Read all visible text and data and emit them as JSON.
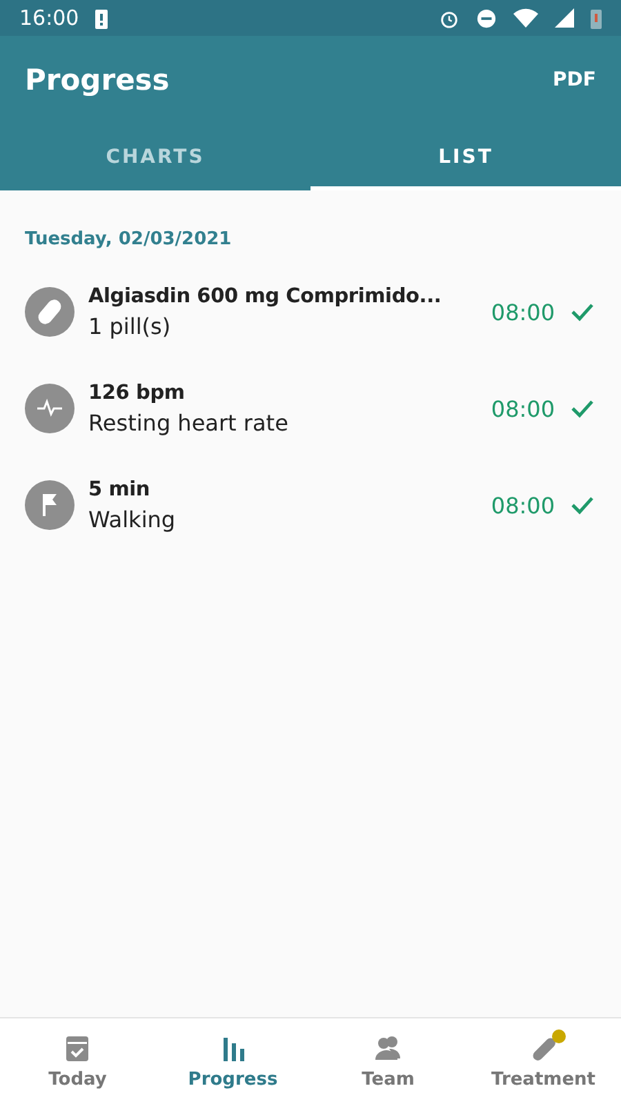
{
  "status_bar": {
    "time": "16:00"
  },
  "app_bar": {
    "title": "Progress",
    "action": "PDF"
  },
  "tabs": [
    {
      "label": "CHARTS",
      "selected": false
    },
    {
      "label": "LIST",
      "selected": true
    }
  ],
  "date_header": "Tuesday, 02/03/2021",
  "entries": [
    {
      "kind": "pill",
      "title": "Algiasdin 600 mg Comprimido...",
      "subtitle": "1 pill(s)",
      "time": "08:00",
      "done": true
    },
    {
      "kind": "heart",
      "title": "126 bpm",
      "subtitle": "Resting heart rate",
      "time": "08:00",
      "done": true
    },
    {
      "kind": "flag",
      "title": "5 min",
      "subtitle": "Walking",
      "time": "08:00",
      "done": true
    }
  ],
  "bottom_nav": [
    {
      "kind": "today",
      "label": "Today",
      "selected": false,
      "badge": false
    },
    {
      "kind": "progress",
      "label": "Progress",
      "selected": true,
      "badge": false
    },
    {
      "kind": "team",
      "label": "Team",
      "selected": false,
      "badge": false
    },
    {
      "kind": "treatment",
      "label": "Treatment",
      "selected": false,
      "badge": true
    }
  ]
}
